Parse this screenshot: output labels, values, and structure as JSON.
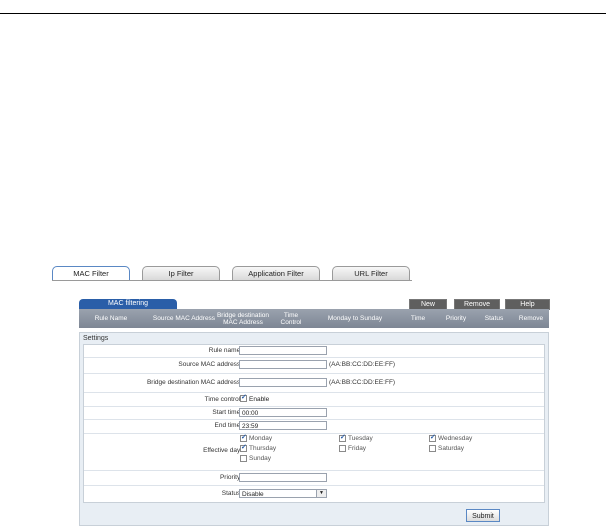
{
  "tabs": [
    "MAC Filter",
    "Ip Filter",
    "Application Filter",
    "URL Filter"
  ],
  "panel": {
    "tab_label": "MAC filtering",
    "buttons": {
      "new": "New",
      "remove": "Remove",
      "help": "Help"
    },
    "columns": [
      "Rule Name",
      "Source MAC Address",
      "Bridge destination MAC Address",
      "Time Control",
      "Monday to Sunday",
      "Time",
      "Priority",
      "Status",
      "Remove"
    ]
  },
  "settings": {
    "title": "Settings",
    "rule_name": {
      "label": "Rule name:",
      "value": ""
    },
    "source_mac": {
      "label": "Source MAC address:",
      "value": "",
      "hint": "(AA:BB:CC:DD:EE:FF)"
    },
    "bridge_mac": {
      "label": "Bridge destination MAC address:",
      "value": "",
      "hint": "(AA:BB:CC:DD:EE:FF)"
    },
    "time_control": {
      "label": "Time control:",
      "option": "Enable",
      "checked": true
    },
    "start_time": {
      "label": "Start time:",
      "value": "00:00"
    },
    "end_time": {
      "label": "End time:",
      "value": "23:59"
    },
    "effective_day": {
      "label": "Effective day:",
      "days": [
        "Monday",
        "Tuesday",
        "Wednesday",
        "Thursday",
        "Friday",
        "Saturday",
        "Sunday"
      ]
    },
    "priority": {
      "label": "Priority:",
      "value": ""
    },
    "status": {
      "label": "Status:",
      "value": "Disable"
    },
    "submit": "Submit"
  }
}
